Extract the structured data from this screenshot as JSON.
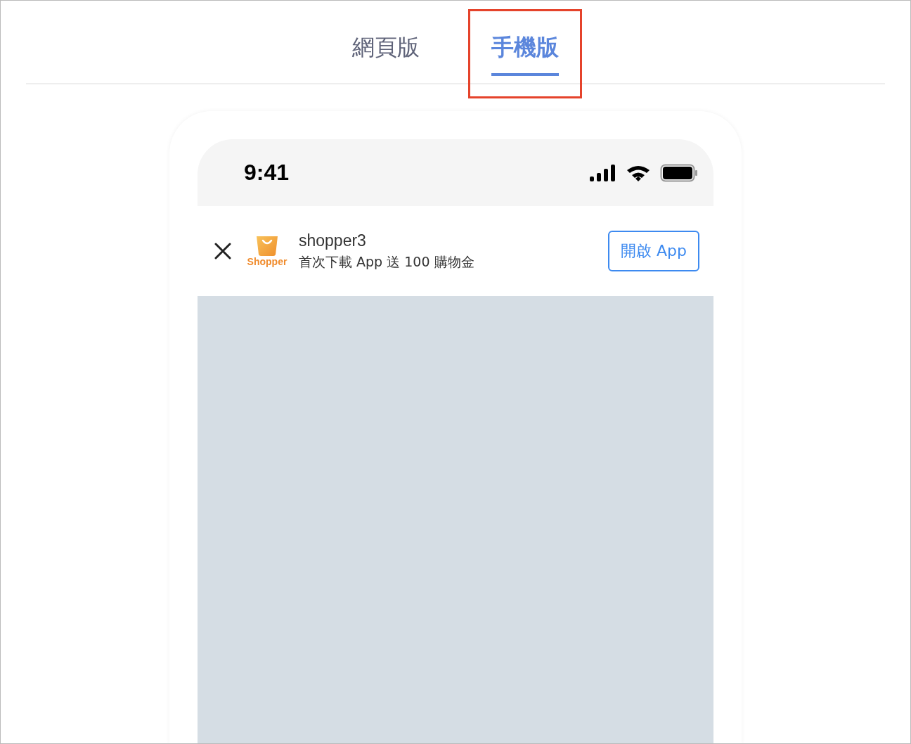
{
  "tabs": [
    {
      "label": "網頁版",
      "selected": false,
      "highlighted": false
    },
    {
      "label": "手機版",
      "selected": true,
      "highlighted": true
    }
  ],
  "status_bar": {
    "time": "9:41"
  },
  "app_banner": {
    "logo_label": "Shopper",
    "app_name": "shopper3",
    "promo": "首次下載 App 送 100 購物金",
    "open_button": "開啟 App"
  },
  "content": {
    "kind": "placeholder"
  }
}
